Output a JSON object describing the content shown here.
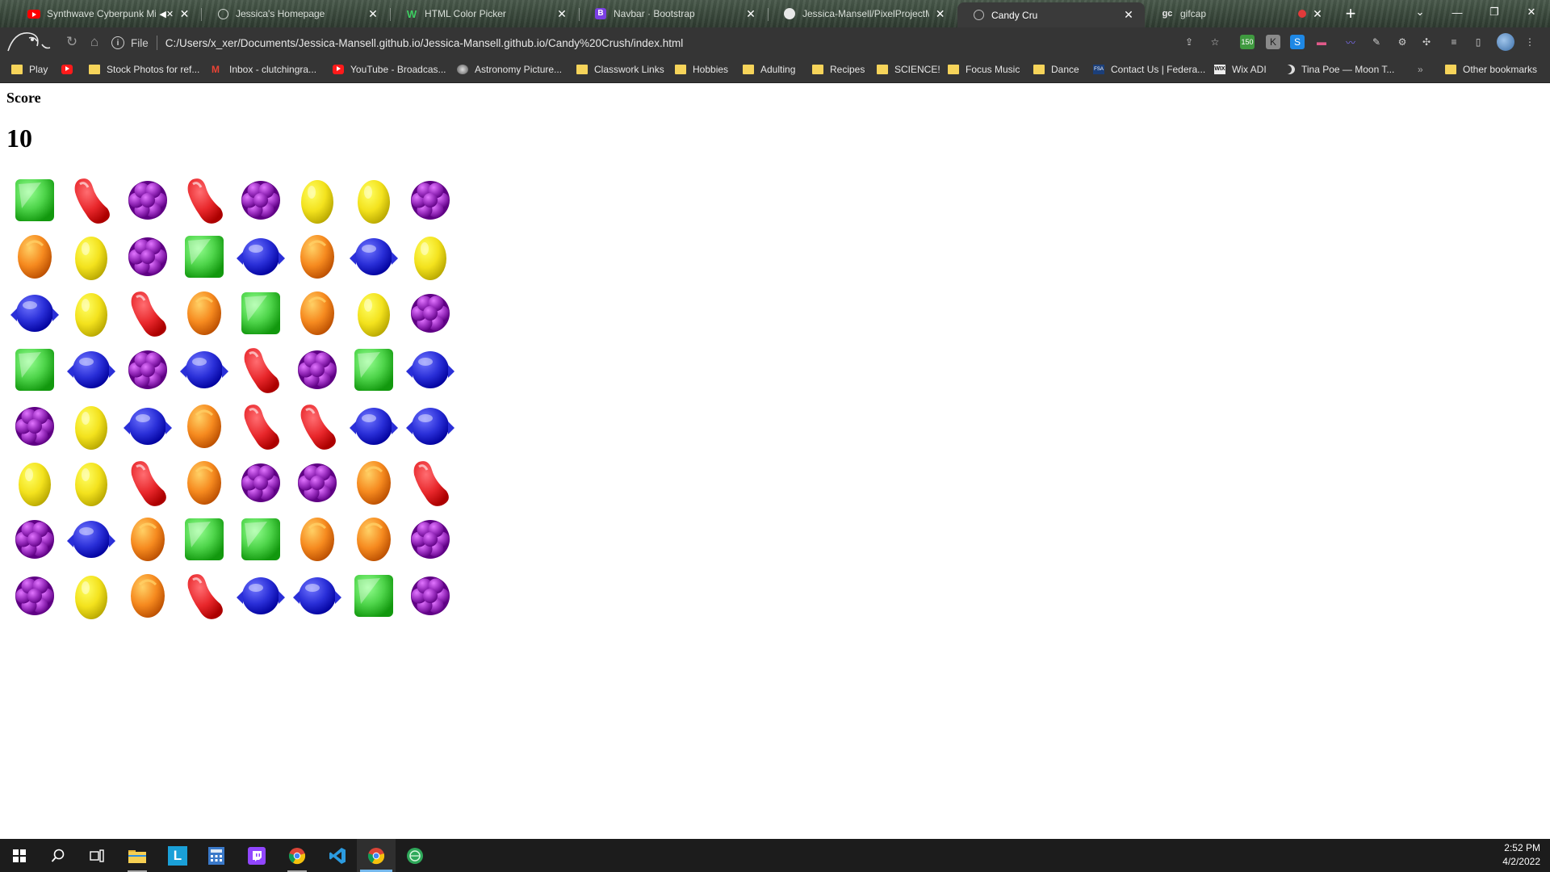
{
  "browser": {
    "tabs": [
      {
        "title": "Synthwave Cyberpunk Mixt",
        "favicon": "youtube-icon",
        "muted": true,
        "active": false
      },
      {
        "title": "Jessica's Homepage",
        "favicon": "globe-icon",
        "active": false
      },
      {
        "title": "HTML Color Picker",
        "favicon": "w3schools-icon",
        "active": false
      },
      {
        "title": "Navbar · Bootstrap",
        "favicon": "bootstrap-icon",
        "active": false
      },
      {
        "title": "Jessica-Mansell/PixelProjectMa",
        "favicon": "github-icon",
        "active": false
      },
      {
        "title": "Candy Cru",
        "favicon": "globe-icon",
        "active": true
      },
      {
        "title": "gifcap",
        "favicon": "gifcap-icon",
        "recording": true,
        "active": false
      }
    ],
    "address_bar": {
      "scheme_label": "File",
      "url": "C:/Users/x_xer/Documents/Jessica-Mansell.github.io/Jessica-Mansell.github.io/Candy%20Crush/index.html"
    },
    "extension_badge": "150",
    "bookmarks": [
      {
        "label": "Play",
        "icon": "folder-icon"
      },
      {
        "label": "",
        "icon": "youtube-icon"
      },
      {
        "label": "Stock Photos for ref...",
        "icon": "folder-icon"
      },
      {
        "label": "Inbox - clutchingra...",
        "icon": "gmail-icon"
      },
      {
        "label": "YouTube - Broadcas...",
        "icon": "youtube-icon"
      },
      {
        "label": "Astronomy Picture...",
        "icon": "apod-icon"
      },
      {
        "label": "Classwork Links",
        "icon": "folder-icon"
      },
      {
        "label": "Hobbies",
        "icon": "folder-icon"
      },
      {
        "label": "Adulting",
        "icon": "folder-icon"
      },
      {
        "label": "Recipes",
        "icon": "folder-icon"
      },
      {
        "label": "SCIENCE!",
        "icon": "folder-icon"
      },
      {
        "label": "Focus Music",
        "icon": "folder-icon"
      },
      {
        "label": "Dance",
        "icon": "folder-icon"
      },
      {
        "label": "Contact Us | Federa...",
        "icon": "fsa-icon"
      },
      {
        "label": "Wix ADI",
        "icon": "wix-icon"
      },
      {
        "label": "Tina Poe — Moon T...",
        "icon": "moon-icon"
      }
    ],
    "bookmarks_overflow": "»",
    "other_bookmarks": "Other bookmarks"
  },
  "game": {
    "score_label": "Score",
    "score_value": "10",
    "candy_colors": {
      "green": "#4ed44a",
      "red": "#e8272b",
      "purple": "#9b2fc0",
      "yellow": "#f3e21d",
      "orange": "#f68a1f",
      "blue": "#2a2fd8"
    },
    "grid": [
      [
        "green",
        "red",
        "purple",
        "red",
        "purple",
        "yellow",
        "yellow",
        "purple"
      ],
      [
        "orange",
        "yellow",
        "purple",
        "green",
        "blue",
        "orange",
        "blue",
        "yellow"
      ],
      [
        "blue",
        "yellow",
        "red",
        "orange",
        "green",
        "orange",
        "yellow",
        "purple"
      ],
      [
        "green",
        "blue",
        "purple",
        "blue",
        "red",
        "purple",
        "green",
        "blue"
      ],
      [
        "purple",
        "yellow",
        "blue",
        "orange",
        "red",
        "red",
        "blue",
        "blue"
      ],
      [
        "yellow",
        "yellow",
        "red",
        "orange",
        "purple",
        "purple",
        "orange",
        "red"
      ],
      [
        "purple",
        "blue",
        "orange",
        "green",
        "green",
        "orange",
        "orange",
        "purple"
      ],
      [
        "purple",
        "yellow",
        "orange",
        "red",
        "blue",
        "blue",
        "green",
        "purple"
      ]
    ]
  },
  "taskbar": {
    "apps": [
      {
        "name": "start-button",
        "icon": "windows-icon"
      },
      {
        "name": "search-button",
        "icon": "search-icon"
      },
      {
        "name": "task-view-button",
        "icon": "task-view-icon"
      },
      {
        "name": "file-explorer-button",
        "icon": "folder-icon"
      },
      {
        "name": "app-l-button",
        "icon": "l-icon"
      },
      {
        "name": "calculator-button",
        "icon": "calculator-icon"
      },
      {
        "name": "twitch-button",
        "icon": "twitch-icon"
      },
      {
        "name": "chrome-button-1",
        "icon": "chrome-icon"
      },
      {
        "name": "vscode-button",
        "icon": "vscode-icon"
      },
      {
        "name": "chrome-button-2",
        "icon": "chrome-icon"
      },
      {
        "name": "app-green-button",
        "icon": "globe-icon"
      }
    ],
    "clock": {
      "time": "2:52 PM",
      "date": "4/2/2022"
    }
  }
}
